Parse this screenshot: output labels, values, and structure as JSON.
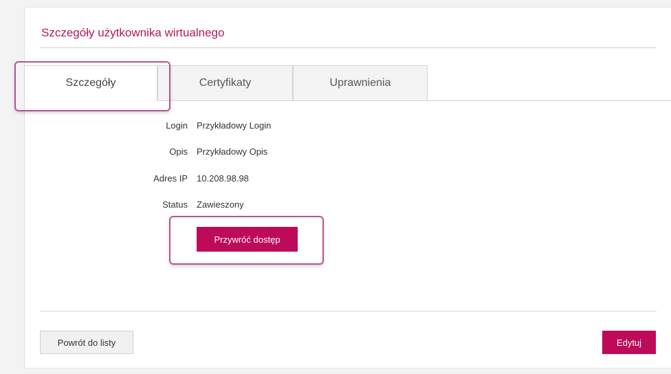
{
  "page": {
    "title": "Szczegóły użytkownika wirtualnego"
  },
  "tabs": [
    {
      "label": "Szczegóły",
      "active": true
    },
    {
      "label": "Certyfikaty",
      "active": false
    },
    {
      "label": "Uprawnienia",
      "active": false
    }
  ],
  "details": {
    "login_label": "Login",
    "login_value": "Przykładowy Login",
    "opis_label": "Opis",
    "opis_value": "Przykładowy Opis",
    "ip_label": "Adres IP",
    "ip_value": "10.208.98.98",
    "status_label": "Status",
    "status_value": "Zawieszony"
  },
  "actions": {
    "restore_label": "Przywróć dostęp",
    "back_label": "Powrót do listy",
    "edit_label": "Edytuj"
  },
  "colors": {
    "accent": "#bd0b5a",
    "title": "#b3185a",
    "highlight": "#b05a8c"
  }
}
